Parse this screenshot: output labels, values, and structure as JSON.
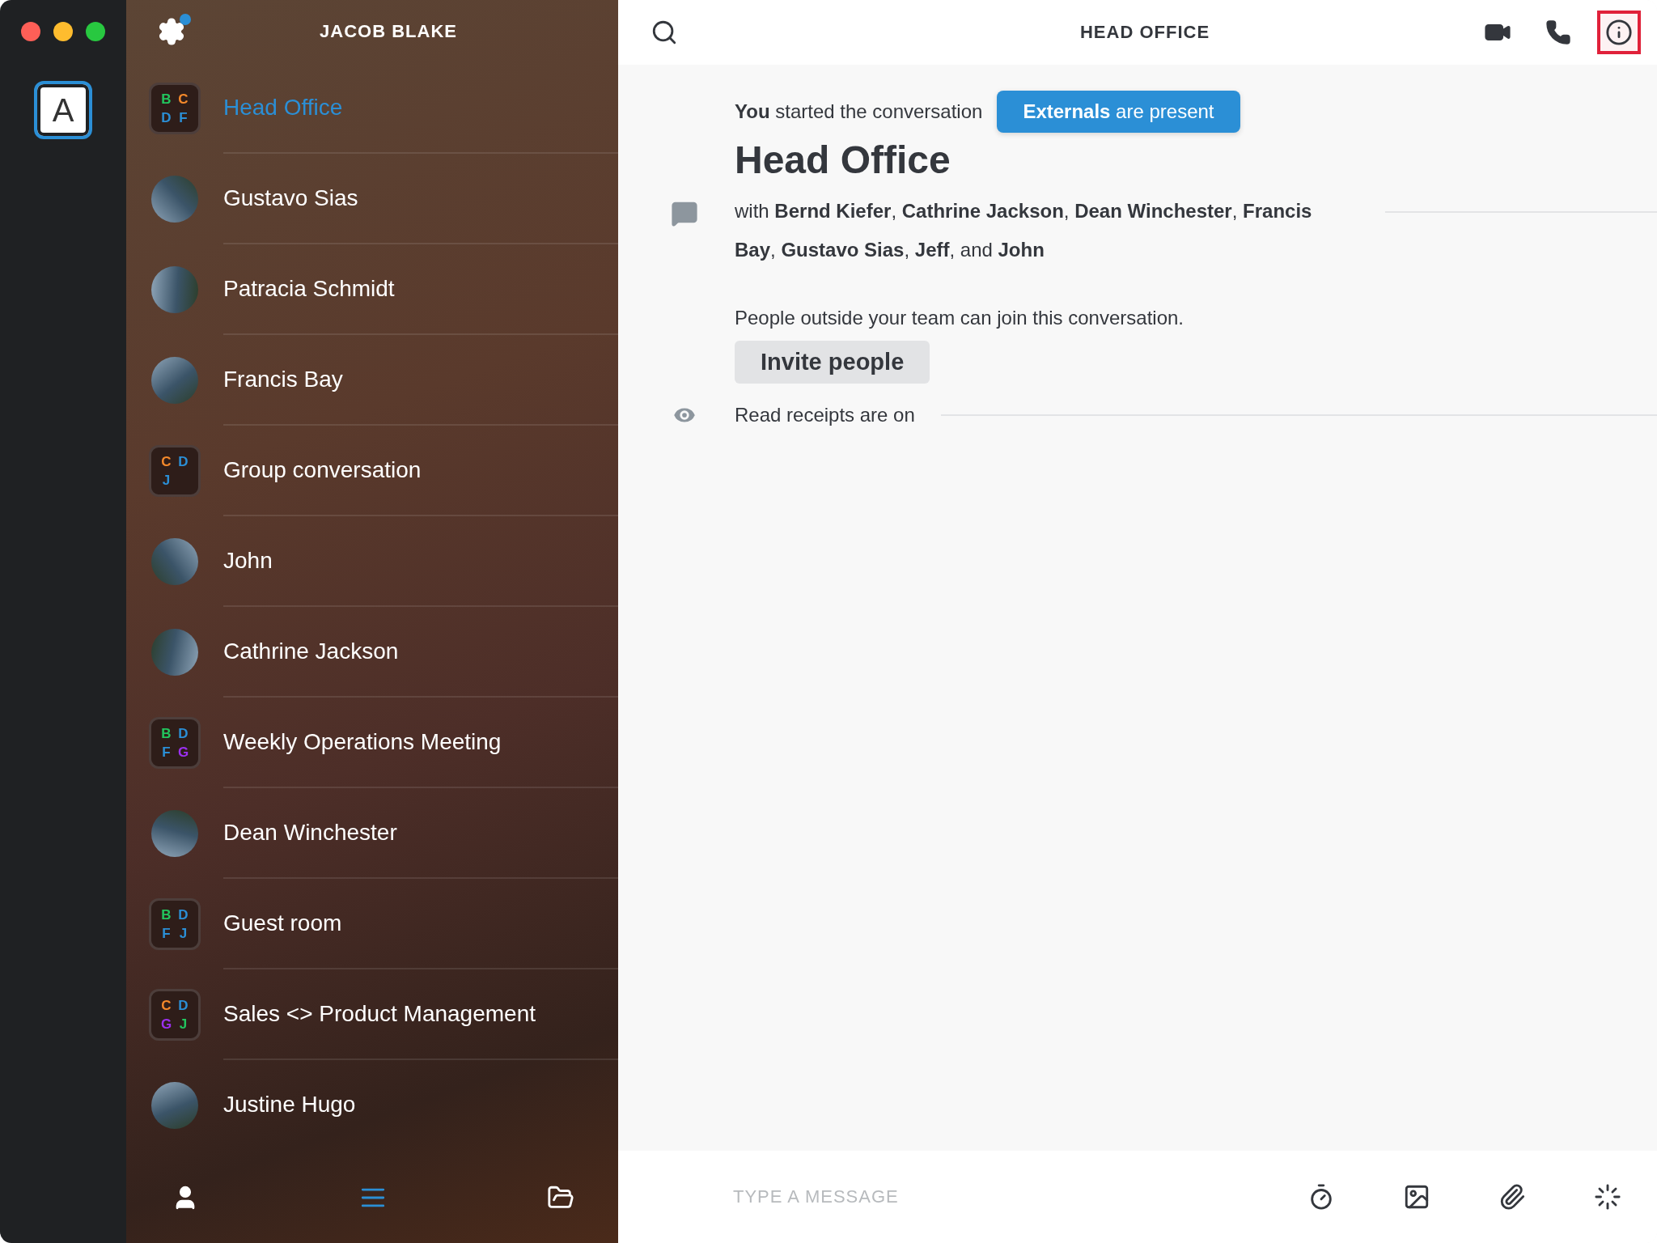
{
  "window": {
    "controls": [
      {
        "kind": "close"
      },
      {
        "kind": "minimize"
      },
      {
        "kind": "maximize"
      }
    ]
  },
  "account": {
    "initial": "A",
    "selected": true
  },
  "sidebar": {
    "title": "JACOB BLAKE",
    "settings_badge": true,
    "conversations": [
      {
        "kind": "group",
        "name": "Head Office",
        "selected": true,
        "initials": [
          {
            "letter": "B",
            "color": "#22c55e"
          },
          {
            "letter": "C",
            "color": "#f5892b"
          },
          {
            "letter": "D",
            "color": "#2b8fd6"
          },
          {
            "letter": "F",
            "color": "#2b8fd6"
          }
        ]
      },
      {
        "kind": "person",
        "name": "Gustavo Sias",
        "selected": false
      },
      {
        "kind": "person",
        "name": "Patracia Schmidt",
        "selected": false
      },
      {
        "kind": "person",
        "name": "Francis Bay",
        "selected": false
      },
      {
        "kind": "group",
        "name": "Group conversation",
        "selected": false,
        "initials": [
          {
            "letter": "C",
            "color": "#f5892b"
          },
          {
            "letter": "D",
            "color": "#2b8fd6"
          },
          {
            "letter": "J",
            "color": "#2b8fd6"
          }
        ]
      },
      {
        "kind": "person",
        "name": "John",
        "selected": false
      },
      {
        "kind": "person",
        "name": "Cathrine Jackson",
        "selected": false
      },
      {
        "kind": "group",
        "name": "Weekly Operations Meeting",
        "selected": false,
        "initials": [
          {
            "letter": "B",
            "color": "#22c55e"
          },
          {
            "letter": "D",
            "color": "#2b8fd6"
          },
          {
            "letter": "F",
            "color": "#2b8fd6"
          },
          {
            "letter": "G",
            "color": "#9b30f0"
          }
        ]
      },
      {
        "kind": "person",
        "name": "Dean Winchester",
        "selected": false
      },
      {
        "kind": "group",
        "name": "Guest room",
        "selected": false,
        "initials": [
          {
            "letter": "B",
            "color": "#22c55e"
          },
          {
            "letter": "D",
            "color": "#2b8fd6"
          },
          {
            "letter": "F",
            "color": "#2b8fd6"
          },
          {
            "letter": "J",
            "color": "#2b8fd6"
          }
        ]
      },
      {
        "kind": "group",
        "name": "Sales <> Product Management",
        "selected": false,
        "initials": [
          {
            "letter": "C",
            "color": "#f5892b"
          },
          {
            "letter": "D",
            "color": "#2b8fd6"
          },
          {
            "letter": "G",
            "color": "#9b30f0"
          },
          {
            "letter": "J",
            "color": "#22c55e"
          }
        ]
      },
      {
        "kind": "person",
        "name": "Justine Hugo",
        "selected": false
      }
    ],
    "nav": [
      {
        "kind": "contacts",
        "selected": false
      },
      {
        "kind": "conversations",
        "selected": true
      },
      {
        "kind": "archive",
        "selected": false
      }
    ]
  },
  "header": {
    "title": "HEAD OFFICE",
    "actions": [
      {
        "kind": "video",
        "highlighted": false
      },
      {
        "kind": "call",
        "highlighted": false
      },
      {
        "kind": "info",
        "highlighted": true
      }
    ]
  },
  "conversation": {
    "started": "**You** started the conversation",
    "badge": "**Externals** are present",
    "title": "Head Office",
    "participants": "with **Bernd Kiefer**, **Cathrine Jackson**, **Dean Winchester**, **Francis Bay**, **Gustavo Sias**, **Jeff**, and **John**",
    "guest_note": "People outside your team can join this conversation.",
    "invite_button": "Invite people",
    "receipts": "Read receipts are on"
  },
  "composer": {
    "placeholder": "TYPE A MESSAGE",
    "tools": [
      {
        "kind": "timer"
      },
      {
        "kind": "image"
      },
      {
        "kind": "attachment"
      },
      {
        "kind": "ping"
      }
    ]
  }
}
